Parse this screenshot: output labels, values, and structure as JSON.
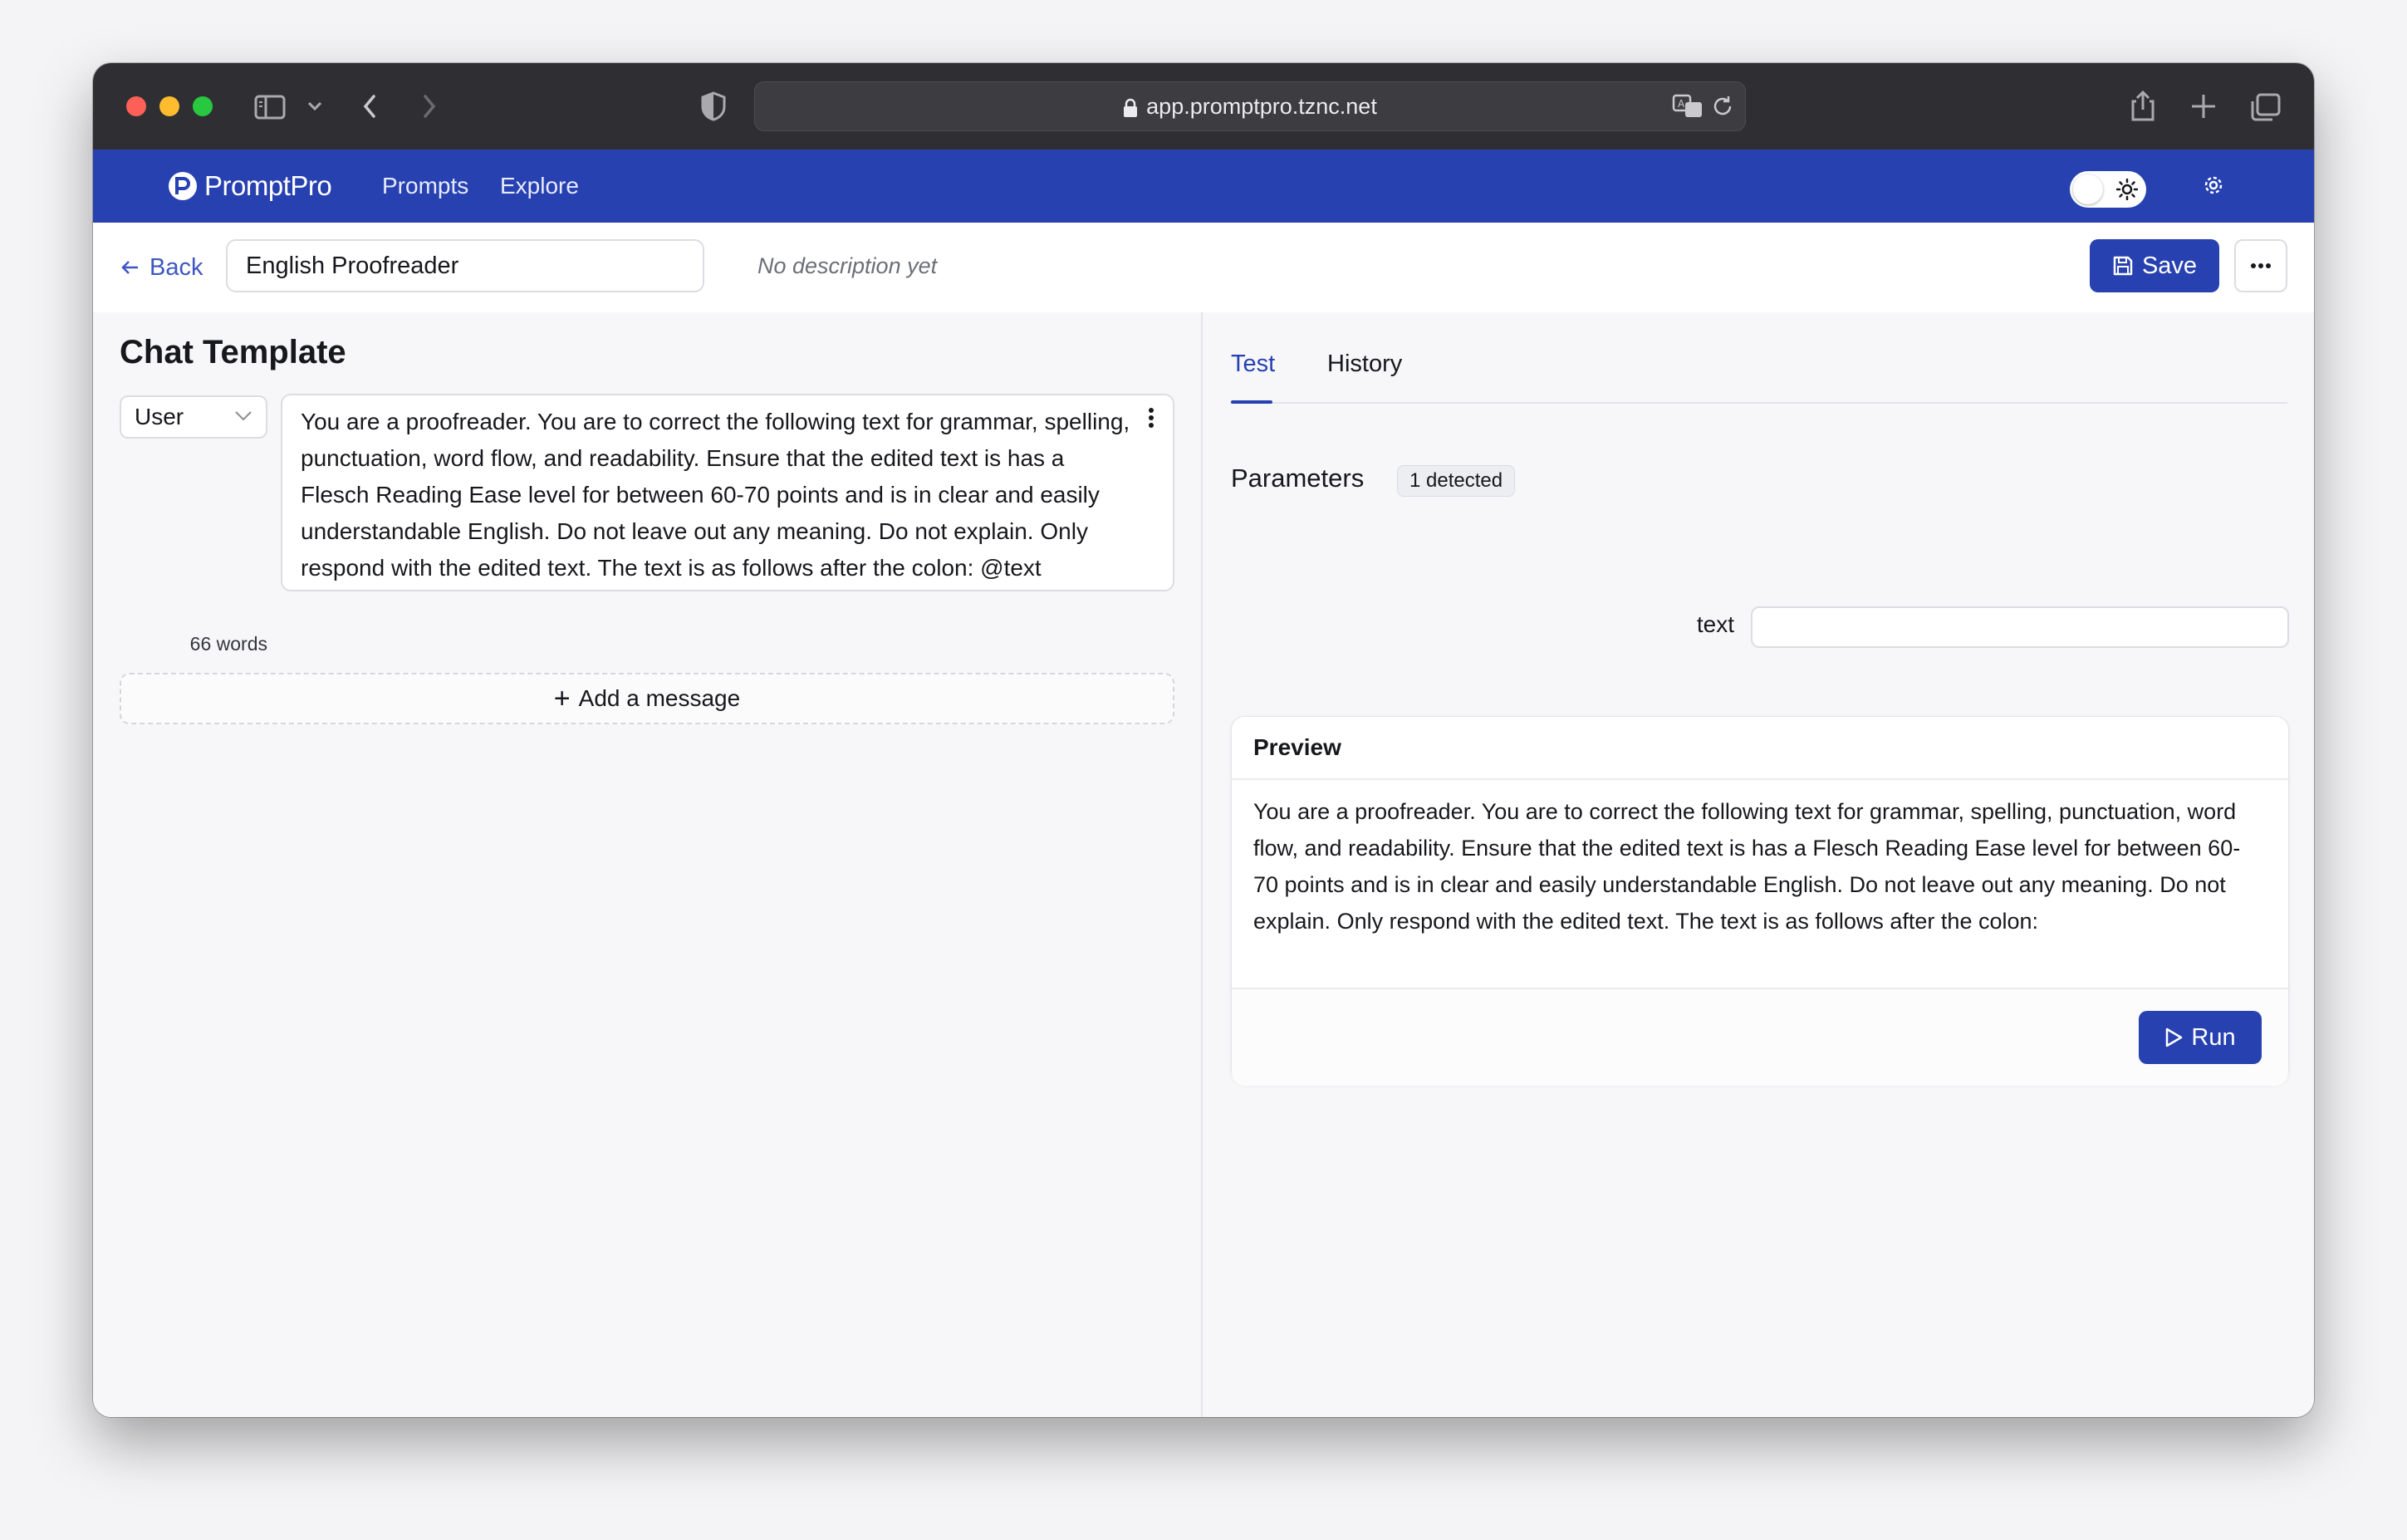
{
  "browser": {
    "url": "app.promptpro.tznc.net"
  },
  "nav": {
    "brand": "PromptPro",
    "links": [
      "Prompts",
      "Explore"
    ]
  },
  "toolbar": {
    "back_label": "Back",
    "prompt_name": "English Proofreader",
    "description": "No description yet",
    "save_label": "Save"
  },
  "chat_template": {
    "title": "Chat Template",
    "message": {
      "role": "User",
      "word_count": "66 words",
      "content": "You are a proofreader. You are to correct the following text for grammar, spelling, punctuation, word flow, and readability. Ensure that the edited text is has a Flesch Reading Ease level for between 60-70 points and is in clear and easily understandable English. Do not leave out any meaning. Do not explain. Only respond with the edited text. The text is as follows after the colon: @text"
    },
    "add_message_label": "Add a message"
  },
  "test_panel": {
    "tabs": [
      "Test",
      "History"
    ],
    "active_tab": "Test",
    "parameters_label": "Parameters",
    "detected_badge": "1 detected",
    "parameters": [
      {
        "name": "text",
        "value": ""
      }
    ],
    "preview": {
      "title": "Preview",
      "content": "You are a proofreader. You are to correct the following text for grammar, spelling, punctuation, word flow, and readability. Ensure that the edited text is has a Flesch Reading Ease level for between 60-70 points and is in clear and easily understandable English. Do not leave out any meaning. Do not explain. Only respond with the edited text. The text is as follows after the colon:"
    },
    "run_label": "Run"
  },
  "colors": {
    "brand": "#2741b0",
    "titlebar": "#2f2f33"
  }
}
